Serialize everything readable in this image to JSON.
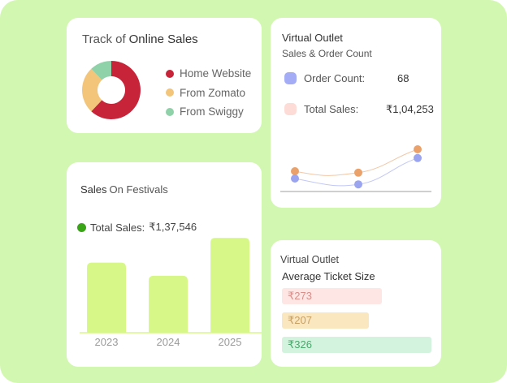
{
  "online_sales": {
    "title_prefix": "Track of",
    "title_main": "Online Sales",
    "chart_data": {
      "type": "pie",
      "categories": [
        "Home Website",
        "From Zomato",
        "From Swiggy"
      ],
      "values": [
        62,
        26,
        12
      ],
      "colors": [
        "#c7243a",
        "#f2c57a",
        "#8fd1a8"
      ]
    }
  },
  "virtual_outlet": {
    "title": "Virtual Outlet",
    "subtitle": "Sales & Order Count",
    "order_label": "Order Count:",
    "order_value": "68",
    "sales_label": "Total Sales:",
    "sales_value": "₹1,04,253",
    "colors": {
      "order": "#a3acf4",
      "sales": "#fddcd8"
    },
    "chart_data": {
      "type": "line",
      "x": [
        1,
        2,
        3
      ],
      "series": [
        {
          "values": [
            40,
            38,
            70
          ],
          "color": "#eaa26a"
        },
        {
          "values": [
            30,
            22,
            58
          ],
          "color": "#9aa4ef"
        }
      ],
      "ylim": [
        0,
        100
      ]
    }
  },
  "festivals": {
    "title_bold": "Sales",
    "title_rest": "On Festivals",
    "total_label": "Total Sales:",
    "total_value": "₹1,37,546",
    "chart_data": {
      "type": "bar",
      "categories": [
        "2023",
        "2024",
        "2025"
      ],
      "values": [
        85,
        69,
        115
      ],
      "ylim": [
        0,
        120
      ],
      "bar_color": "#d7f889"
    }
  },
  "ticket": {
    "title": "Virtual Outlet",
    "subtitle": "Average Ticket Size",
    "chart_data": {
      "type": "bar",
      "values": [
        273,
        207,
        326
      ],
      "labels": [
        "₹273",
        "₹207",
        "₹326"
      ],
      "colors": [
        "#fde6e4",
        "#fae6bf",
        "#d3f3df"
      ],
      "text_colors": [
        "#d88f8a",
        "#c7a064",
        "#4aa86c"
      ]
    }
  }
}
